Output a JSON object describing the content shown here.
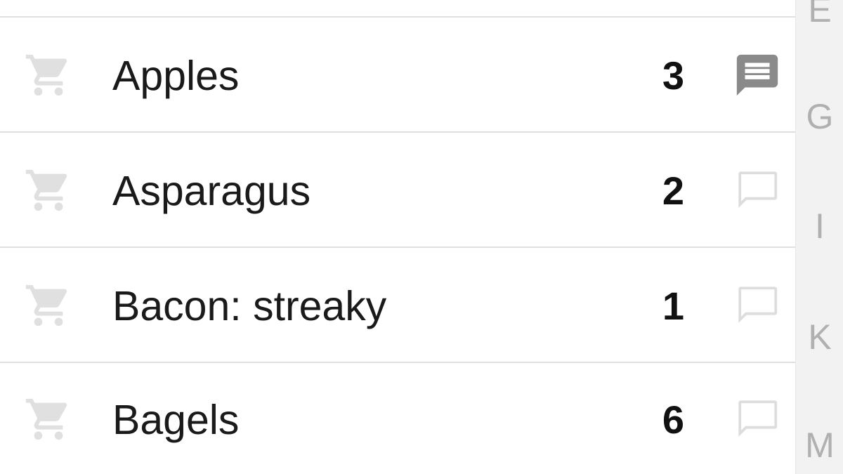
{
  "items": [
    {
      "name": "Apples",
      "quantity": "3",
      "cart_icon": "shopping-cart-icon",
      "note_icon": "comment-filled-icon",
      "has_note": true
    },
    {
      "name": "Asparagus",
      "quantity": "2",
      "cart_icon": "shopping-cart-icon",
      "note_icon": "comment-outline-icon",
      "has_note": false
    },
    {
      "name": "Bacon: streaky",
      "quantity": "1",
      "cart_icon": "shopping-cart-icon",
      "note_icon": "comment-outline-icon",
      "has_note": false
    },
    {
      "name": "Bagels",
      "quantity": "6",
      "cart_icon": "shopping-cart-icon",
      "note_icon": "comment-outline-icon",
      "has_note": false
    }
  ],
  "index_bar": {
    "letters": [
      "E",
      "G",
      "I",
      "K",
      "M"
    ]
  },
  "colors": {
    "cart_icon": "#e0e0e0",
    "note_filled": "#8a8a8a",
    "note_outline": "#dddddd",
    "divider": "#e0e0e0",
    "index_bg": "#f2f2f2",
    "index_text": "#b0b0b0"
  }
}
